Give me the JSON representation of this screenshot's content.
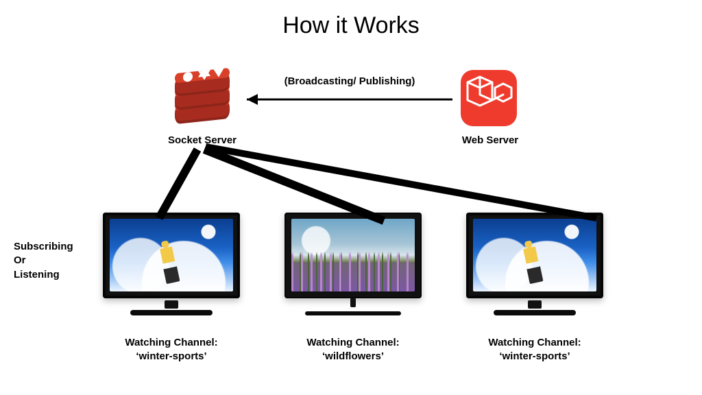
{
  "title": "How it Works",
  "top_arrow_label": "(Broadcasting/ Publishing)",
  "socket_server_label": "Socket Server",
  "web_server_label": "Web Server",
  "subscribe_label_line1": "Subscribing",
  "subscribe_label_line2": "Or",
  "subscribe_label_line3": "Listening",
  "clients": [
    {
      "caption_line1": "Watching Channel:",
      "caption_line2": "‘winter-sports’",
      "scene": "snowboard"
    },
    {
      "caption_line1": "Watching Channel:",
      "caption_line2": "‘wildflowers’",
      "scene": "flowers"
    },
    {
      "caption_line1": "Watching Channel:",
      "caption_line2": "‘winter-sports’",
      "scene": "snowboard"
    }
  ],
  "icons": {
    "socket_server": "redis-icon",
    "web_server": "laravel-icon"
  },
  "colors": {
    "redis": "#D9402A",
    "laravel": "#EF3B2D",
    "line": "#000000"
  }
}
